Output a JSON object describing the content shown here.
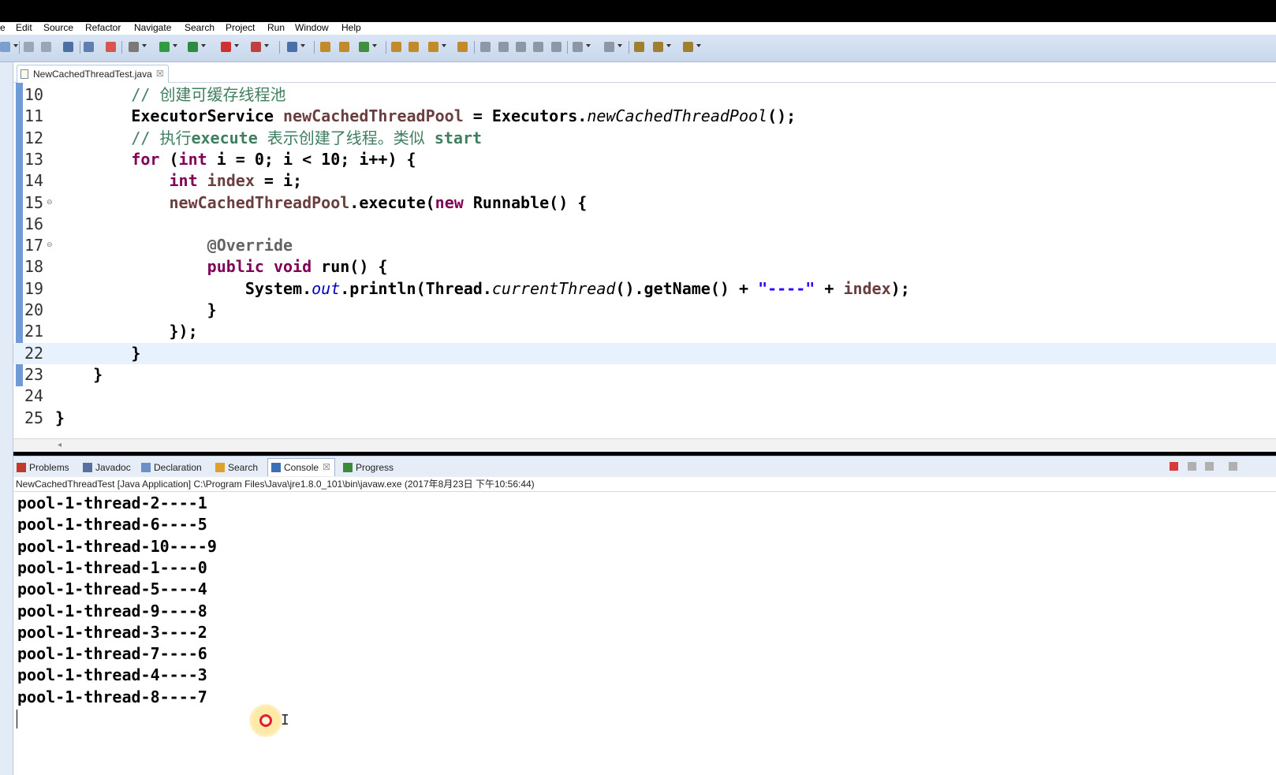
{
  "menu": [
    "e",
    "Edit",
    "Source",
    "Refactor",
    "Navigate",
    "Search",
    "Project",
    "Run",
    "Window",
    "Help"
  ],
  "editor": {
    "tab_label": "NewCachedThreadTest.java",
    "close_glyph": "☒",
    "lines": [
      {
        "n": "10",
        "tokens": [
          [
            "        ",
            ""
          ],
          [
            "// 创建可缓存线程池",
            "cm"
          ]
        ]
      },
      {
        "n": "11",
        "tokens": [
          [
            "        ExecutorService ",
            ""
          ],
          [
            "newCachedThreadPool",
            "var"
          ],
          [
            " = Executors.",
            ""
          ],
          [
            "newCachedThreadPool",
            "st"
          ],
          [
            "();",
            ""
          ]
        ]
      },
      {
        "n": "12",
        "tokens": [
          [
            "        ",
            ""
          ],
          [
            "// 执行",
            "cm"
          ],
          [
            "execute",
            "cmb"
          ],
          [
            " 表示创建了线程。类似 ",
            "cm"
          ],
          [
            "start",
            "cmb"
          ]
        ]
      },
      {
        "n": "13",
        "tokens": [
          [
            "        ",
            ""
          ],
          [
            "for",
            "kw"
          ],
          [
            " (",
            ""
          ],
          [
            "int",
            "kw"
          ],
          [
            " i = 0; i < 10; i++) {",
            ""
          ]
        ]
      },
      {
        "n": "14",
        "tokens": [
          [
            "            ",
            ""
          ],
          [
            "int",
            "kw"
          ],
          [
            " ",
            ""
          ],
          [
            "index",
            "var"
          ],
          [
            " = i;",
            ""
          ]
        ]
      },
      {
        "n": "15",
        "tokens": [
          [
            "            ",
            ""
          ],
          [
            "newCachedThreadPool",
            "var"
          ],
          [
            ".execute(",
            ""
          ],
          [
            "new",
            "kw"
          ],
          [
            " Runnable() {",
            ""
          ]
        ]
      },
      {
        "n": "16",
        "tokens": []
      },
      {
        "n": "17",
        "tokens": [
          [
            "                ",
            ""
          ],
          [
            "@Override",
            "ann"
          ]
        ]
      },
      {
        "n": "18",
        "tokens": [
          [
            "                ",
            ""
          ],
          [
            "public",
            "kw"
          ],
          [
            " ",
            ""
          ],
          [
            "void",
            "kw"
          ],
          [
            " run() {",
            ""
          ]
        ]
      },
      {
        "n": "19",
        "tokens": [
          [
            "                    System.",
            ""
          ],
          [
            "out",
            "fld"
          ],
          [
            ".println(Thread.",
            ""
          ],
          [
            "currentThread",
            "st"
          ],
          [
            "().getName() + ",
            ""
          ],
          [
            "\"----\"",
            "str"
          ],
          [
            " + ",
            ""
          ],
          [
            "index",
            "var"
          ],
          [
            ");",
            ""
          ]
        ]
      },
      {
        "n": "20",
        "tokens": [
          [
            "                }",
            ""
          ]
        ]
      },
      {
        "n": "21",
        "tokens": [
          [
            "            });",
            ""
          ]
        ]
      },
      {
        "n": "22",
        "tokens": [
          [
            "        }",
            ""
          ]
        ]
      },
      {
        "n": "23",
        "tokens": [
          [
            "    }",
            ""
          ]
        ]
      },
      {
        "n": "24",
        "tokens": []
      },
      {
        "n": "25",
        "tokens": [
          [
            "}",
            ""
          ]
        ]
      }
    ],
    "current_line": "22"
  },
  "views": {
    "tabs": [
      {
        "label": "Problems",
        "icon": "problems-icon",
        "color": "#c0392b"
      },
      {
        "label": "Javadoc",
        "icon": "javadoc-icon",
        "color": "#5a6fa0"
      },
      {
        "label": "Declaration",
        "icon": "declaration-icon",
        "color": "#6b8fc7"
      },
      {
        "label": "Search",
        "icon": "search-icon",
        "color": "#e0a030"
      },
      {
        "label": "Console",
        "icon": "console-icon",
        "color": "#3b6fb6"
      },
      {
        "label": "Progress",
        "icon": "progress-icon",
        "color": "#3a8a3a"
      }
    ],
    "active_tab": "Console"
  },
  "console": {
    "header": "NewCachedThreadTest [Java Application] C:\\Program Files\\Java\\jre1.8.0_101\\bin\\javaw.exe (2017年8月23日 下午10:56:44)",
    "output": [
      "pool-1-thread-2----1",
      "pool-1-thread-6----5",
      "pool-1-thread-10----9",
      "pool-1-thread-1----0",
      "pool-1-thread-5----4",
      "pool-1-thread-9----8",
      "pool-1-thread-3----2",
      "pool-1-thread-7----6",
      "pool-1-thread-4----3",
      "pool-1-thread-8----7"
    ]
  },
  "colors": {
    "keyword": "#7f0055",
    "comment": "#3f7f5f",
    "string": "#2a00ff",
    "field": "#0000c0",
    "current_line": "#e8f2fe"
  }
}
